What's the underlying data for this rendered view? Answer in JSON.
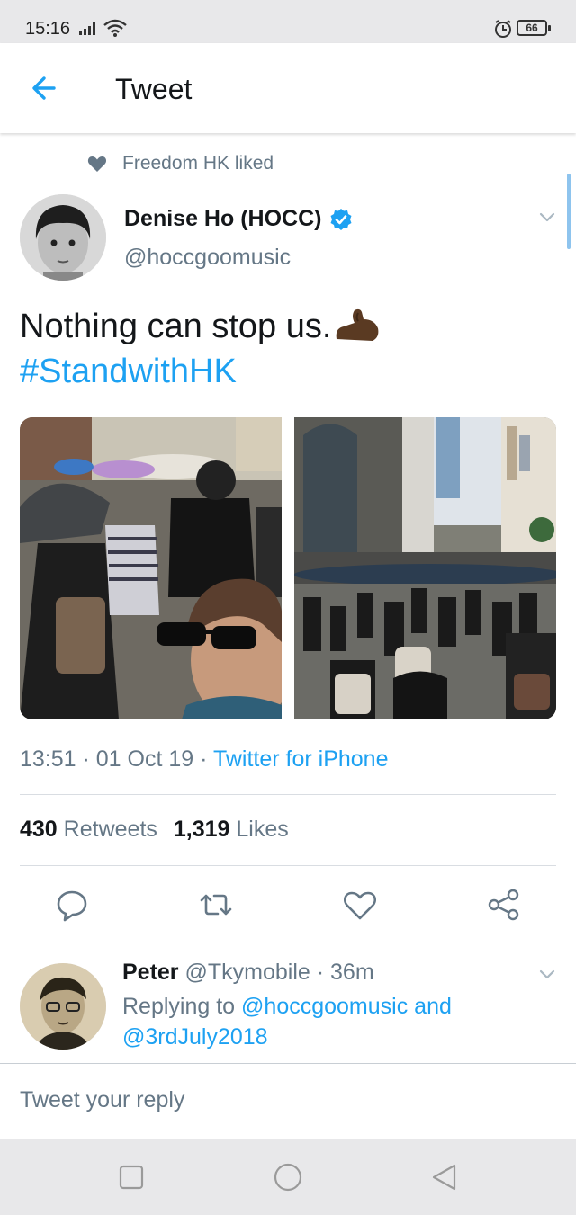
{
  "status_bar": {
    "time": "15:16",
    "battery": "66"
  },
  "app_bar": {
    "title": "Tweet"
  },
  "tweet": {
    "social_context": "Freedom HK liked",
    "author_name": "Denise Ho (HOCC)",
    "author_handle": "@hoccgoomusic",
    "text": "Nothing can stop us.",
    "hashtag": "#StandwithHK",
    "timestamp": "13:51 · 01 Oct 19 · ",
    "source": "Twitter for iPhone",
    "retweets_count": "430",
    "retweets_label": "Retweets",
    "likes_count": "1,319",
    "likes_label": "Likes"
  },
  "reply": {
    "author_name": "Peter",
    "author_handle_time": "@Tkymobile · 36m",
    "replying_prefix": "Replying to ",
    "replying_to_1": "@hoccgoomusic",
    "replying_joiner": " and",
    "replying_to_2": "@3rdJuly2018"
  },
  "compose": {
    "placeholder": "Tweet your reply"
  },
  "colors": {
    "accent": "#1da1f2",
    "secondary_text": "#657786",
    "primary_text": "#14171a"
  },
  "icons": {
    "back": "arrow-left-icon",
    "liked": "heart-filled-icon",
    "verified": "verified-badge-icon",
    "menu": "chevron-down-icon",
    "reply": "reply-bubble-icon",
    "retweet": "retweet-icon",
    "like": "heart-outline-icon",
    "share": "share-icon"
  }
}
